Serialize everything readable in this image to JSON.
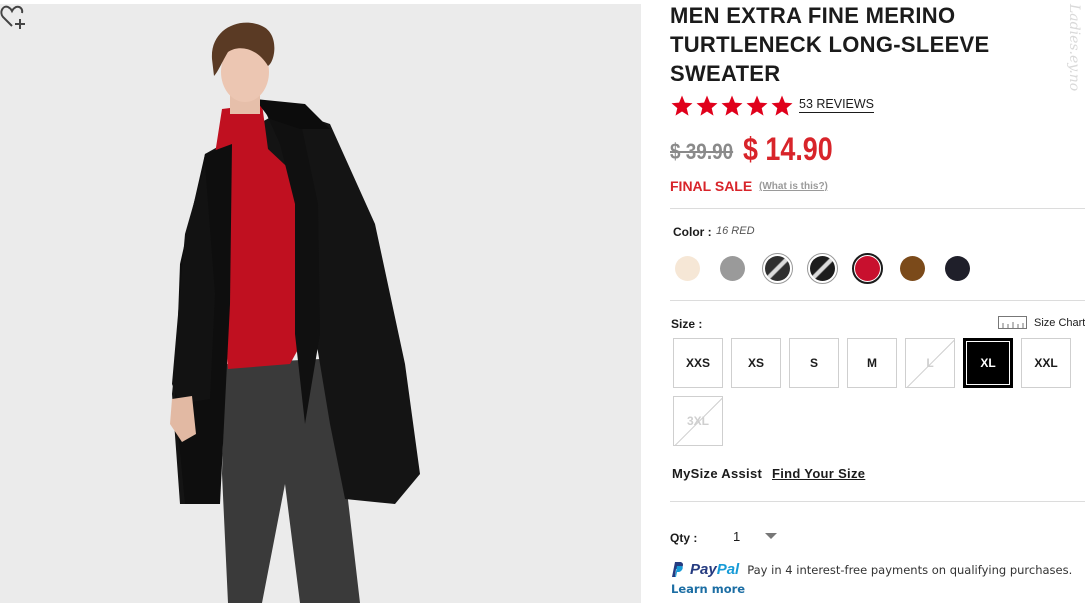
{
  "product": {
    "title": "MEN EXTRA FINE MERINO TURTLENECK LONG-SLEEVE SWEATER",
    "rating": 5,
    "reviews_label": "53 REVIEWS",
    "old_price": "$ 39.90",
    "new_price": "$ 14.90",
    "sale_label": "FINAL SALE",
    "sale_help_link": "(What is this?)"
  },
  "color": {
    "label": "Color :",
    "selected_value": "16 RED",
    "swatches": [
      {
        "name": "cream",
        "hex": "#f6e7d6"
      },
      {
        "name": "gray",
        "hex": "#9a9a9a"
      },
      {
        "name": "charcoal-stripe",
        "hex": "#2f2f2f"
      },
      {
        "name": "black-stripe",
        "hex": "#1d1d1d"
      },
      {
        "name": "red",
        "hex": "#c8102e"
      },
      {
        "name": "brown",
        "hex": "#7b4a1a"
      },
      {
        "name": "navy",
        "hex": "#1f1f2a"
      }
    ]
  },
  "size": {
    "label": "Size :",
    "chart_label": "Size Chart",
    "options": [
      {
        "label": "XXS",
        "state": "available"
      },
      {
        "label": "XS",
        "state": "available"
      },
      {
        "label": "S",
        "state": "available"
      },
      {
        "label": "M",
        "state": "available"
      },
      {
        "label": "L",
        "state": "unavailable"
      },
      {
        "label": "XL",
        "state": "selected"
      },
      {
        "label": "XXL",
        "state": "available"
      },
      {
        "label": "3XL",
        "state": "unavailable"
      }
    ]
  },
  "mysize": {
    "label": "MySize Assist",
    "link": "Find Your Size"
  },
  "quantity": {
    "label": "Qty :",
    "value": "1"
  },
  "paypal": {
    "brand_pay": "Pay",
    "brand_pal": "Pal",
    "note": "Pay in 4 interest-free payments on qualifying purchases.",
    "learn_more": "Learn more"
  },
  "watermark": "Ladies.ey.no",
  "colors": {
    "accent_red": "#d8242a",
    "star_red": "#e0001b",
    "paypal_blue": "#253b80"
  }
}
